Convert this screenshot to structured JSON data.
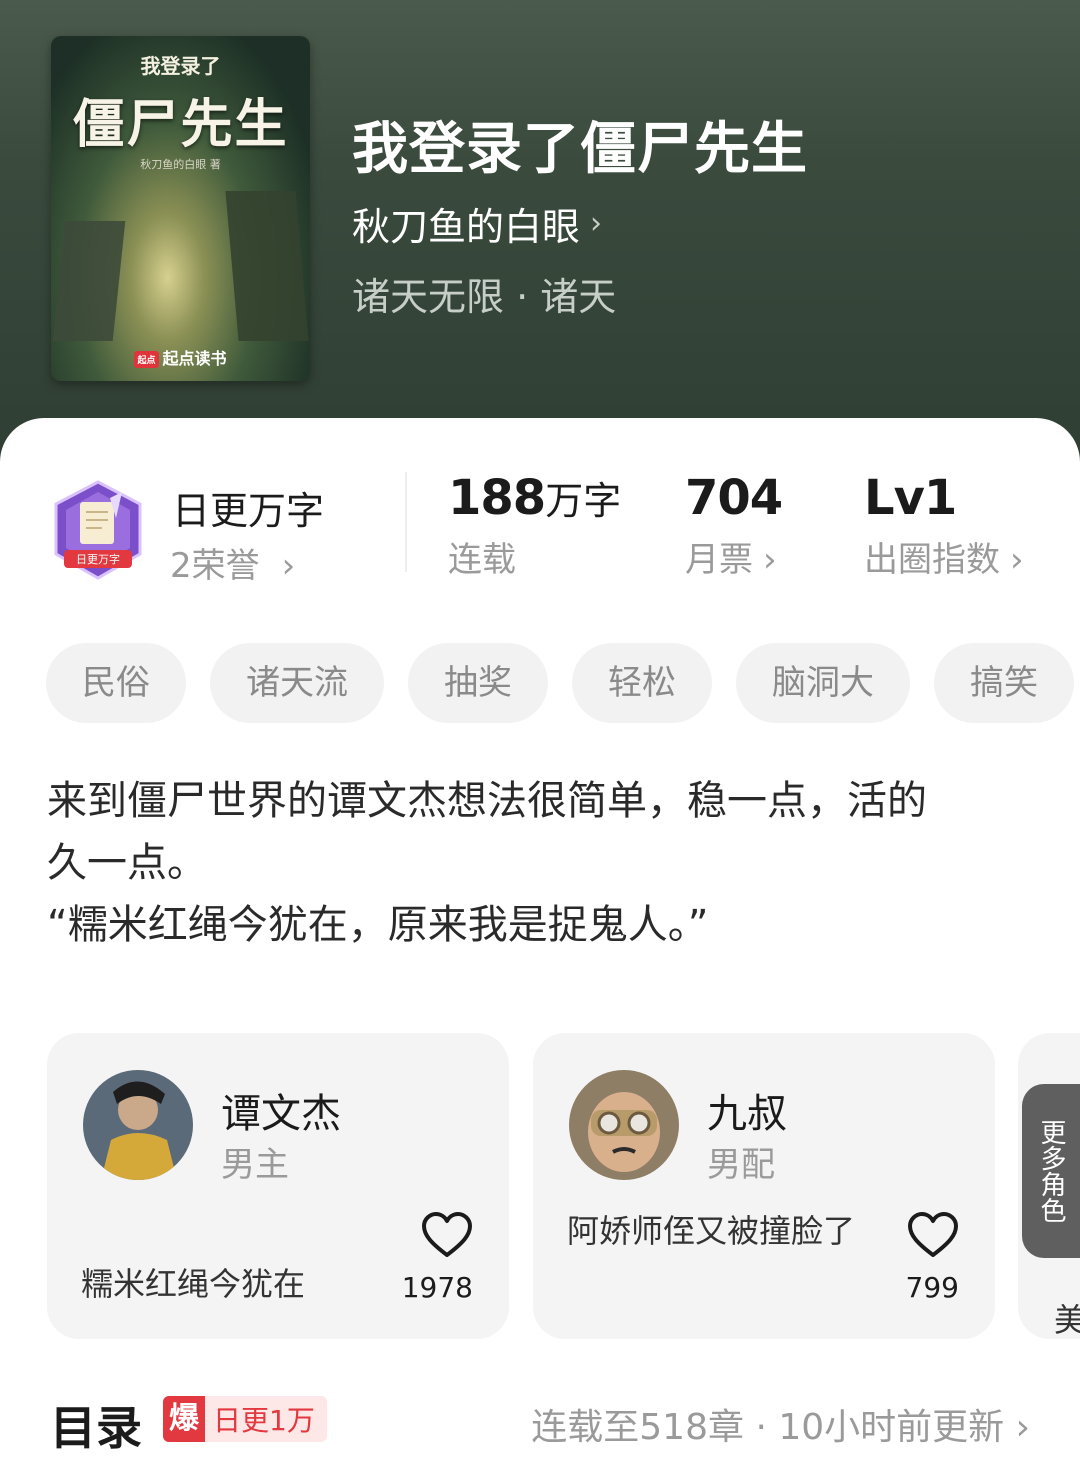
{
  "book": {
    "cover_top": "我登录了",
    "cover_main": "僵尸先生",
    "cover_author": "秋刀鱼的白眼 著",
    "cover_brand": "起点读书",
    "cover_brand_logo": "起点",
    "title": "我登录了僵尸先生",
    "author": "秋刀鱼的白眼",
    "genre": "诸天无限 · 诸天"
  },
  "honor": {
    "title": "日更万字",
    "sub": "2荣誉",
    "badge_text": "日更万字"
  },
  "stats": [
    {
      "value": "188",
      "unit": "万字",
      "label": "连载"
    },
    {
      "value": "704",
      "unit": "",
      "label": "月票"
    },
    {
      "value": "Lv1",
      "unit": "",
      "label": "出圈指数"
    }
  ],
  "tags": [
    "民俗",
    "诸天流",
    "抽奖",
    "轻松",
    "脑洞大",
    "搞笑"
  ],
  "description": {
    "line1": "来到僵尸世界的谭文杰想法很简单，稳一点，活的",
    "line2": "久一点。",
    "line3": "“糯米红绳今犹在，原来我是捉鬼人。”"
  },
  "characters": [
    {
      "name": "谭文杰",
      "role": "男主",
      "quote": "糯米红绳今犹在",
      "likes": "1978"
    },
    {
      "name": "九叔",
      "role": "男配",
      "quote": "阿娇师侄又被撞脸了",
      "likes": "799"
    }
  ],
  "peek_char_text": "美",
  "more_roles": "更多角色",
  "toc": {
    "title": "目录",
    "badge_icon": "爆",
    "badge_text": "日更1万",
    "status": "连载至518章 · 10小时前更新"
  },
  "icons": {
    "chevron": "chevron-right-icon",
    "heart": "heart-outline-icon"
  },
  "colors": {
    "header_bg": "#3a4a3d",
    "accent_red": "#e2383f",
    "muted_text": "#9a9a9a"
  }
}
